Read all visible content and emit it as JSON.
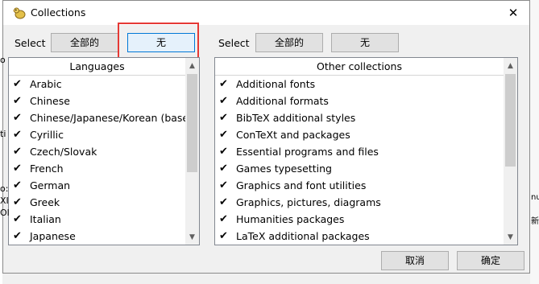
{
  "window": {
    "title": "Collections",
    "close_symbol": "✕"
  },
  "left": {
    "select_label": "Select",
    "all_label": "全部的",
    "none_label": "无",
    "header": "Languages",
    "items": [
      "Arabic",
      "Chinese",
      "Chinese/Japanese/Korean (base)",
      "Cyrillic",
      "Czech/Slovak",
      "French",
      "German",
      "Greek",
      "Italian",
      "Japanese"
    ]
  },
  "right": {
    "select_label": "Select",
    "all_label": "全部的",
    "none_label": "无",
    "header": "Other collections",
    "items": [
      "Additional fonts",
      "Additional formats",
      "BibTeX additional styles",
      "ConTeXt and packages",
      "Essential programs and files",
      "Games typesetting",
      "Graphics and font utilities",
      "Graphics, pictures, diagrams",
      "Humanities packages",
      "LaTeX additional packages"
    ]
  },
  "footer": {
    "cancel_label": "取消",
    "ok_label": "确定"
  },
  "check_glyph": "✔",
  "scroll": {
    "up": "▲",
    "down": "▼"
  },
  "background": {
    "right_char_1": "nu",
    "right_char_2": "新",
    "left_chars": [
      "o",
      "ti",
      "o:",
      "XI",
      "Ol"
    ]
  }
}
